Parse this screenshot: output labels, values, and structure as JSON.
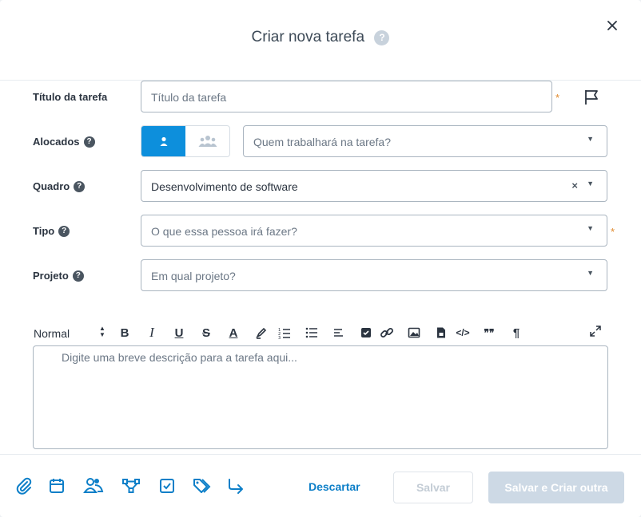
{
  "dialog": {
    "title": "Criar nova tarefa",
    "help_glyph": "?"
  },
  "form": {
    "title_label": "Título da tarefa",
    "title_placeholder": "Título da tarefa",
    "required_mark": "*",
    "assignees_label": "Alocados",
    "assignees_placeholder": "Quem trabalhará na tarefa?",
    "board_label": "Quadro",
    "board_value": "Desenvolvimento de software",
    "clear_glyph": "×",
    "type_label": "Tipo",
    "type_placeholder": "O que essa pessoa irá fazer?",
    "project_label": "Projeto",
    "project_placeholder": "Em qual projeto?",
    "caret_glyph": "▼"
  },
  "editor": {
    "format_value": "Normal",
    "tools": [
      "bold-icon",
      "italic-icon",
      "underline-icon",
      "strikethrough-icon",
      "text-color-icon",
      "highlight-icon",
      "ordered-list-icon",
      "bullet-list-icon",
      "align-left-icon",
      "checklist-icon",
      "link-icon",
      "image-icon",
      "file-icon",
      "code-icon",
      "quote-icon",
      "paragraph-icon",
      "expand-icon"
    ],
    "bold_glyph": "B",
    "italic_glyph": "I",
    "underline_glyph": "U",
    "strike_glyph": "S",
    "color_glyph": "A",
    "code_glyph": "</>",
    "quote_glyph": "❞❞",
    "pilcrow_glyph": "¶",
    "placeholder": "Digite uma breve descrição para a tarefa aqui..."
  },
  "footer": {
    "icons": [
      "attachment-icon",
      "calendar-icon",
      "users-icon",
      "dependencies-icon",
      "checklist-icon",
      "tags-icon",
      "move-icon"
    ],
    "discard_label": "Descartar",
    "save_label": "Salvar",
    "save_new_label": "Salvar e Criar outra"
  },
  "colors": {
    "accent": "#0d8fdc",
    "required": "#e08a2e",
    "disabled_button": "#cdd9e5"
  }
}
